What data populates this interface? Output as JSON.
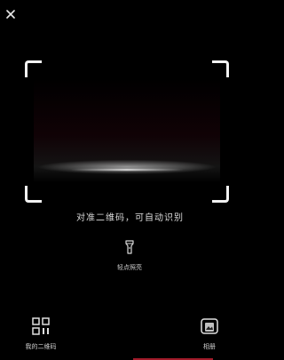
{
  "header": {
    "close_icon": "close-icon"
  },
  "scanner": {
    "hint": "对准二维码，可自动识别"
  },
  "flashlight": {
    "icon": "flashlight-icon",
    "label": "轻点照亮"
  },
  "bottom_bar": {
    "my_qr": {
      "icon": "qr-code-icon",
      "label": "我的二维码"
    },
    "album": {
      "icon": "album-icon",
      "label": "相册"
    }
  },
  "colors": {
    "background": "#000000",
    "accent": "#a11b2a"
  }
}
